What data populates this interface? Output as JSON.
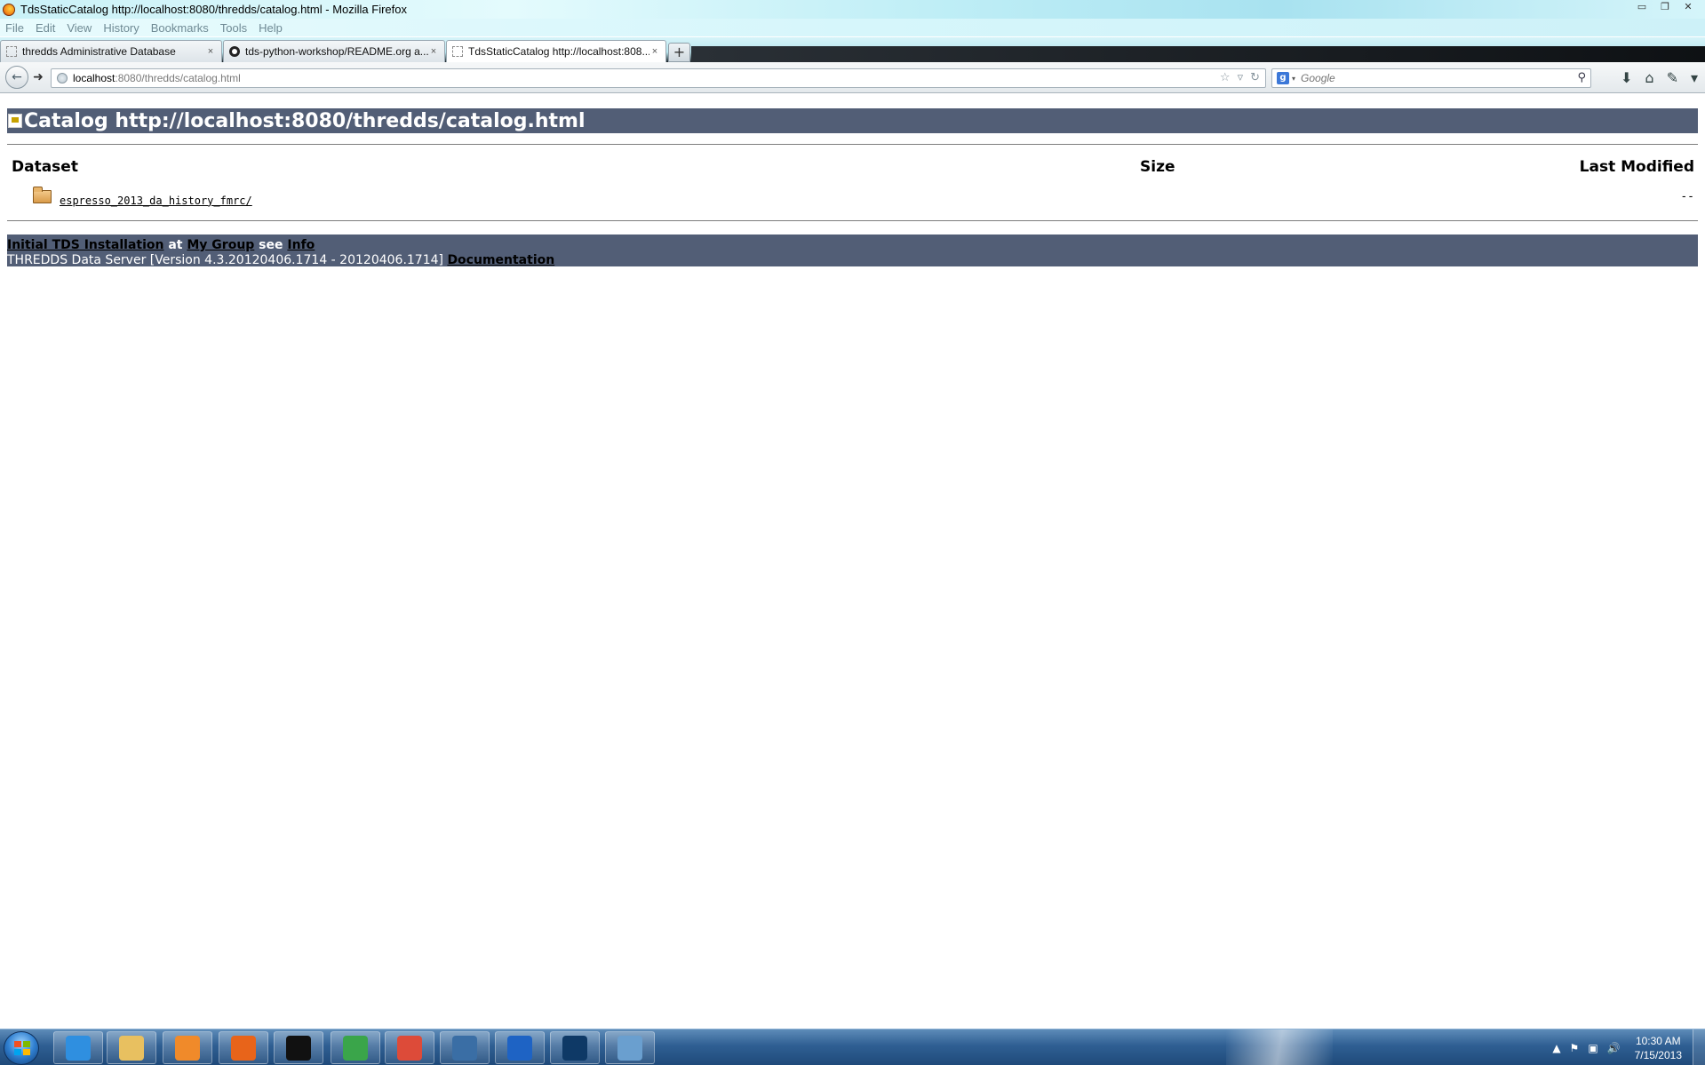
{
  "window": {
    "title": "TdsStaticCatalog http://localhost:8080/thredds/catalog.html - Mozilla Firefox",
    "controls": {
      "minimize": "▭",
      "restore": "❐",
      "close": "✕"
    }
  },
  "menu": {
    "items": [
      "File",
      "Edit",
      "View",
      "History",
      "Bookmarks",
      "Tools",
      "Help"
    ]
  },
  "tabs": [
    {
      "label": "thredds Administrative Database",
      "icon": "page-icon",
      "active": false
    },
    {
      "label": "tds-python-workshop/README.org a...",
      "icon": "github-icon",
      "active": false
    },
    {
      "label": "TdsStaticCatalog http://localhost:808...",
      "icon": "page-icon",
      "active": true
    }
  ],
  "tab_close_glyph": "×",
  "new_tab_glyph": "+",
  "nav": {
    "back_glyph": "←",
    "forward_glyph": "➜",
    "url_host": "localhost",
    "url_path": ":8080/thredds/catalog.html",
    "search_placeholder": "Google",
    "search_engine_glyph": "g",
    "bookmark_star": "☆",
    "dropdown": "▿",
    "reload": "↻",
    "search_glyph": "⚲",
    "download_glyph": "⬇",
    "home_glyph": "⌂",
    "addon_glyph": "✎",
    "menu_dropdown": "▾"
  },
  "catalog": {
    "heading": "Catalog http://localhost:8080/thredds/catalog.html",
    "columns": {
      "dataset": "Dataset",
      "size": "Size",
      "last_modified": "Last Modified"
    },
    "rows": [
      {
        "name": "espresso_2013_da_history_fmrc/",
        "size": "",
        "last_modified": "--"
      }
    ]
  },
  "footer": {
    "installation_link": "Initial TDS Installation",
    "at": " at ",
    "group_link": "My Group",
    "see": " see ",
    "info_link": "Info",
    "server_text": "THREDDS Data Server [Version 4.3.20120406.1714 - 20120406.1714] ",
    "docs_link": "Documentation"
  },
  "taskbar": {
    "apps": [
      {
        "name": "internet-explorer-icon",
        "color": "#2f8fe0"
      },
      {
        "name": "file-explorer-icon",
        "color": "#e8c060"
      },
      {
        "name": "media-player-icon",
        "color": "#f08a2a"
      },
      {
        "name": "firefox-icon",
        "color": "#e8641a"
      },
      {
        "name": "command-prompt-icon",
        "color": "#111111"
      },
      {
        "name": "git-gui-icon",
        "color": "#3aa54a"
      },
      {
        "name": "chrome-icon",
        "color": "#dd4b39"
      },
      {
        "name": "thunderbird-icon",
        "color": "#3a6ea5"
      },
      {
        "name": "intellij-icon",
        "color": "#1e63c4"
      },
      {
        "name": "virtualbox-icon",
        "color": "#0e3966"
      },
      {
        "name": "remote-desktop-icon",
        "color": "#6a9fcf"
      }
    ],
    "tray_icons": {
      "show_hidden": "▲",
      "flag": "⚑",
      "network": "▣",
      "volume": "🔊"
    },
    "clock_time": "10:30 AM",
    "clock_date": "7/15/2013"
  }
}
